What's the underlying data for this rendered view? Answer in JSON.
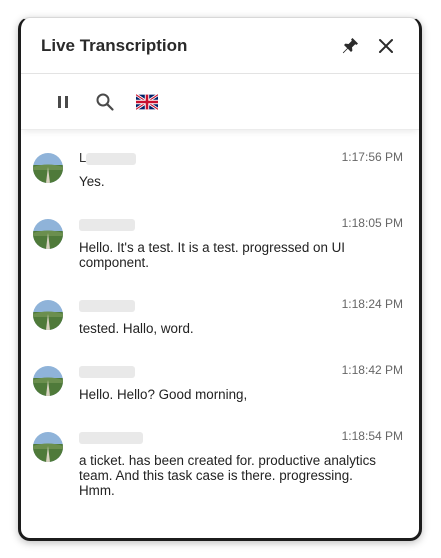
{
  "header": {
    "title": "Live Transcription"
  },
  "toolbar": {
    "pause_icon": "pause-icon",
    "search_icon": "search-icon",
    "language_flag": "uk-flag-icon"
  },
  "entries": [
    {
      "speaker": "L",
      "time": "1:17:56 PM",
      "text": "Yes."
    },
    {
      "speaker": "",
      "time": "1:18:05 PM",
      "text": "Hello. It's a test. It is a test. progressed on UI component."
    },
    {
      "speaker": "",
      "time": "1:18:24 PM",
      "text": "tested. Hallo, word."
    },
    {
      "speaker": "",
      "time": "1:18:42 PM",
      "text": "Hello. Hello? Good morning,"
    },
    {
      "speaker": "",
      "time": "1:18:54 PM",
      "text": "a ticket. has been created for. productive analytics team. And this task case is there. progressing. Hmm."
    }
  ]
}
